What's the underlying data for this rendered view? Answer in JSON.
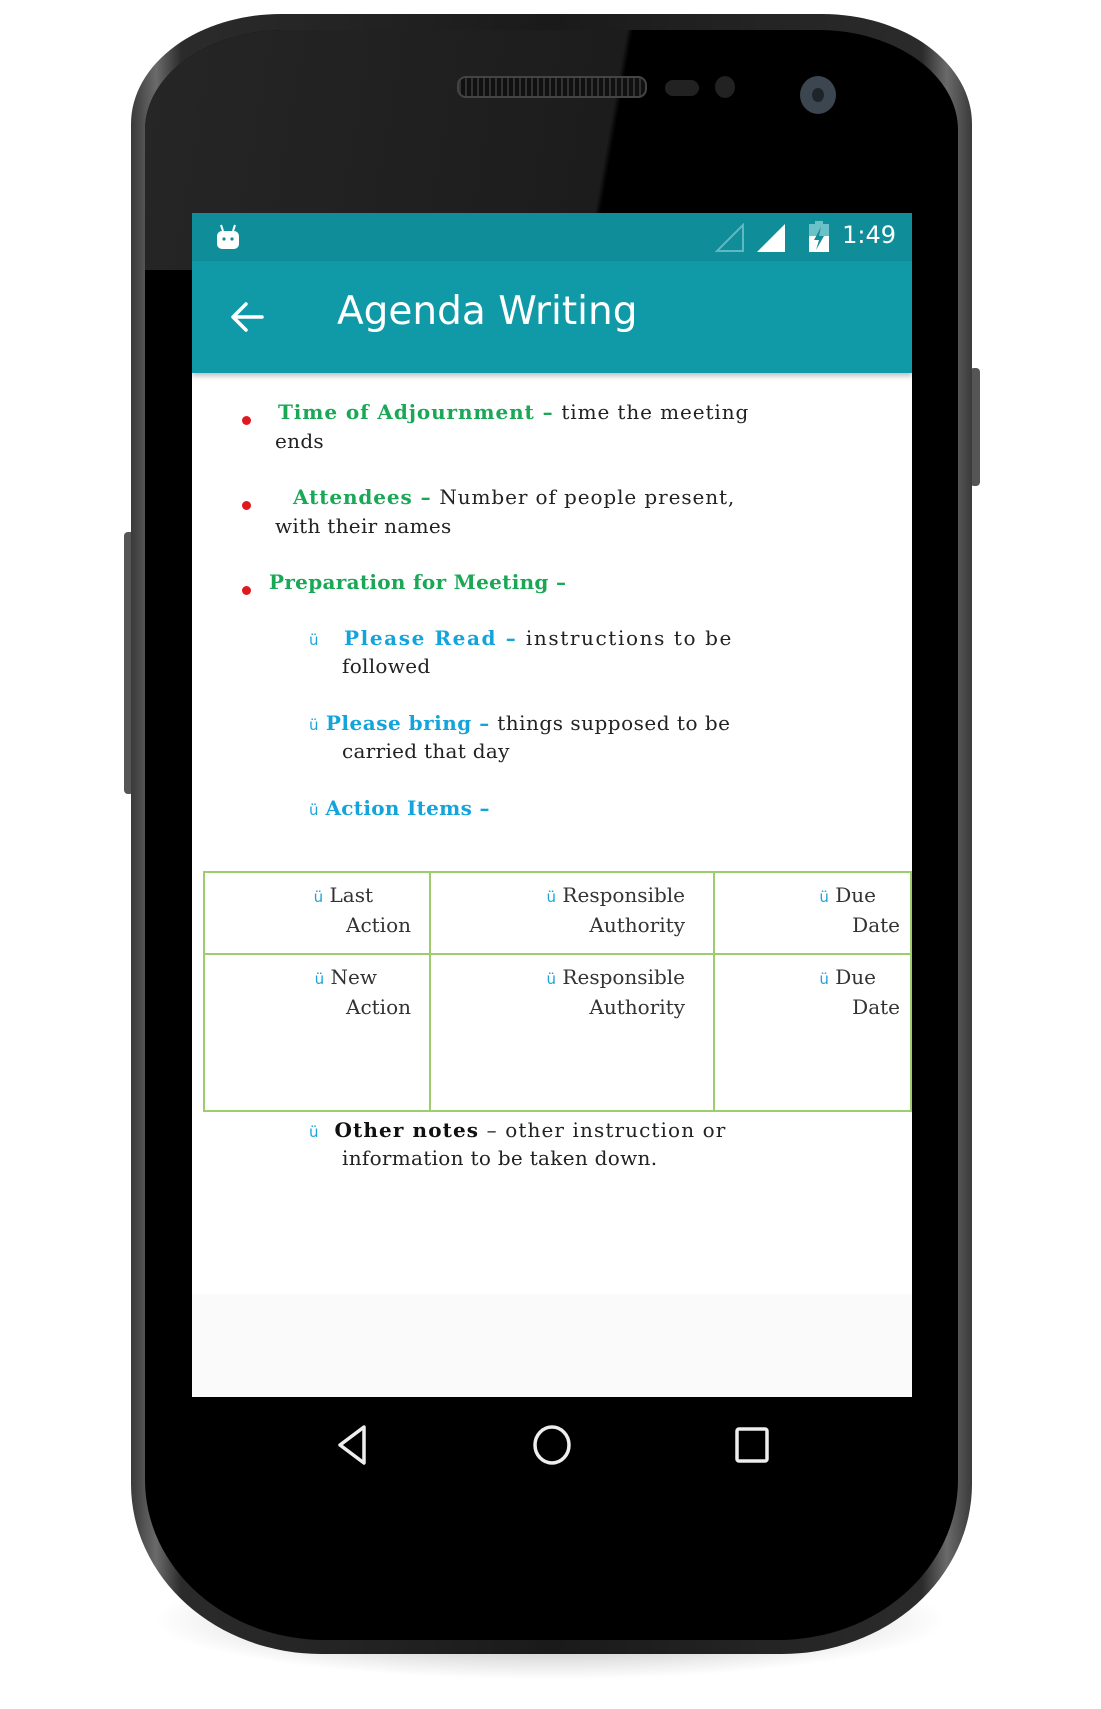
{
  "status_bar": {
    "time": "1:49",
    "icons": [
      "android-notification-icon",
      "signal-empty-icon",
      "signal-full-icon",
      "battery-charging-icon"
    ]
  },
  "toolbar": {
    "title": "Agenda Writing",
    "back_icon": "arrow-left-icon"
  },
  "content": {
    "bullets": [
      {
        "term": "Time of Adjournment",
        "sep": " – ",
        "desc_line1": "time the meeting",
        "desc_line2": "ends"
      },
      {
        "term": "Attendees",
        "sep": " – ",
        "desc_line1": "Number of people present,",
        "desc_line2": "with their names"
      },
      {
        "term": "Preparation for Meeting",
        "sep": " –"
      }
    ],
    "sub_items": [
      {
        "check": "ü",
        "term": "Please Read",
        "sep": " – ",
        "desc_line1": "instructions to be",
        "desc_line2": "followed"
      },
      {
        "check": "ü",
        "term": "Please bring",
        "sep": " – ",
        "desc_line1": "things supposed to be",
        "desc_line2": "carried that day"
      },
      {
        "check": "ü",
        "term": "Action Items",
        "sep": " –"
      }
    ],
    "table": {
      "rows": [
        [
          {
            "check": "ü",
            "line1": "Last",
            "line2": "Action"
          },
          {
            "check": "ü",
            "line1": "Responsible",
            "line2": "Authority"
          },
          {
            "check": "ü",
            "line1": "Due",
            "line2": "Date"
          }
        ],
        [
          {
            "check": "ü",
            "line1": "New",
            "line2": "Action"
          },
          {
            "check": "ü",
            "line1": "Responsible",
            "line2": "Authority"
          },
          {
            "check": "ü",
            "line1": "Due",
            "line2": "Date"
          }
        ]
      ]
    },
    "other_notes": {
      "check": "ü",
      "term": "Other notes",
      "sep": " – ",
      "desc_line1": "other instruction or",
      "desc_line2": "information to be taken down."
    }
  },
  "nav_bar": {
    "back": "nav-back-icon",
    "home": "nav-home-icon",
    "recents": "nav-recents-icon"
  },
  "colors": {
    "status_bar": "#0f8e9a",
    "toolbar": "#109aa8",
    "term_green": "#1aa857",
    "term_blue": "#13a4dc",
    "bullet_red": "#e0191e",
    "table_border": "#9ccf6c"
  }
}
